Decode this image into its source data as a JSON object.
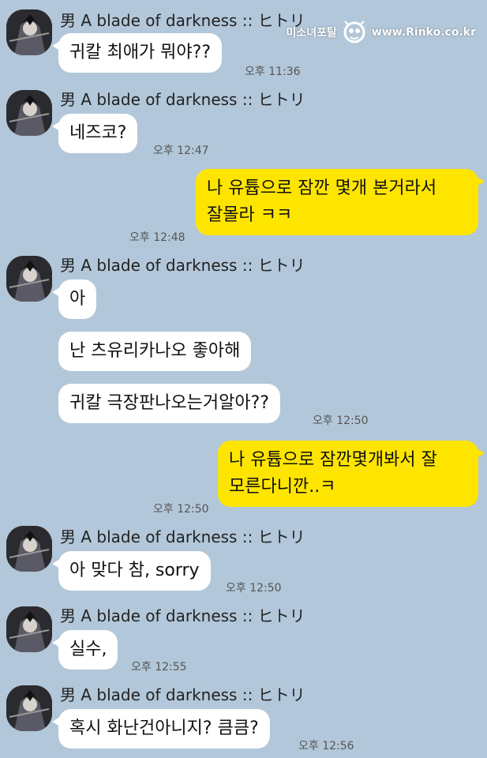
{
  "watermark": {
    "text": "미소녀포탈",
    "url": "www.Rinko.co.kr"
  },
  "sender_name": "男 A blade of darkness :: ヒトリ",
  "messages": {
    "m1": {
      "text": "귀칼 최애가 뭐야??",
      "time": "오후 11:36"
    },
    "m2": {
      "text": "네즈코?",
      "time": "오후 12:47"
    },
    "m3": {
      "line1": "나 유튭으로 잠깐 몇개 본거라서",
      "line2": "잘몰라 ㅋㅋ",
      "time": "오후 12:48"
    },
    "m4a": {
      "text": "아"
    },
    "m4b": {
      "text": "난 츠유리카나오 좋아해"
    },
    "m4c": {
      "text": "귀칼 극장판나오는거알아??",
      "time": "오후 12:50"
    },
    "m5": {
      "line1": "나 유튭으로 잠깐몇개봐서 잘",
      "line2": "모른다니깐..ㅋ",
      "time": "오후 12:50"
    },
    "m6": {
      "text": "아 맞다 참, sorry",
      "time": "오후 12:50"
    },
    "m7": {
      "text": "실수,",
      "time": "오후 12:55"
    },
    "m8": {
      "text": "혹시 화난건아니지? 큼큼?",
      "time": "오후 12:56"
    }
  },
  "colors": {
    "background": "#b2c7d9",
    "my_bubble": "#fee500",
    "their_bubble": "#ffffff"
  },
  "icons": {
    "avatar": "avatar",
    "watermark_logo": "mascot-logo-icon"
  }
}
